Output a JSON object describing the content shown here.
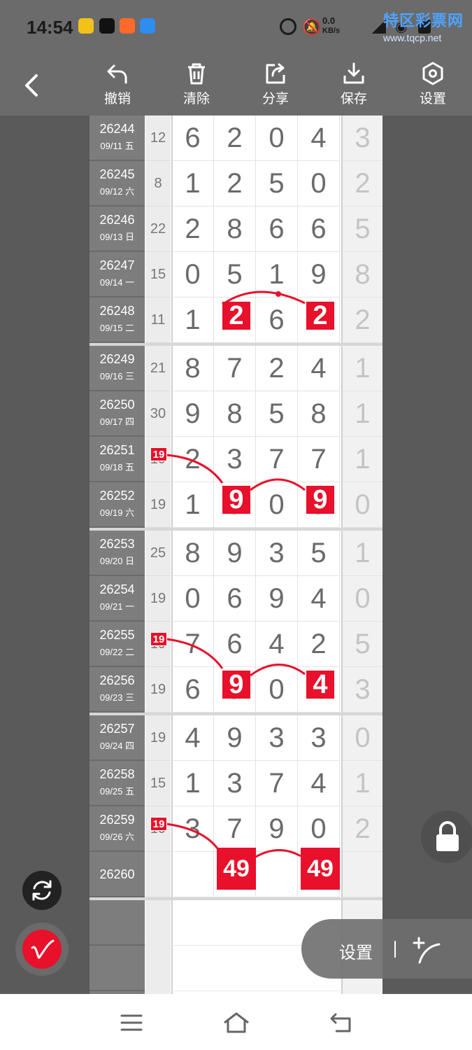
{
  "status_bar": {
    "time": "14:54",
    "net_speed": "0.0",
    "net_unit": "KB/s",
    "watermark_title": "特区彩票网",
    "watermark_url": "www.tqcp.net"
  },
  "toolbar": {
    "undo": "撤销",
    "clear": "清除",
    "share": "分享",
    "save": "保存",
    "settings": "设置"
  },
  "rows": [
    {
      "issue": "26244",
      "date": "09/11 五",
      "sum": "12",
      "digits": [
        "6",
        "2",
        "0",
        "4"
      ],
      "last": "3"
    },
    {
      "issue": "26245",
      "date": "09/12 六",
      "sum": "8",
      "digits": [
        "1",
        "2",
        "5",
        "0"
      ],
      "last": "2"
    },
    {
      "issue": "26246",
      "date": "09/13 日",
      "sum": "22",
      "digits": [
        "2",
        "8",
        "6",
        "6"
      ],
      "last": "5"
    },
    {
      "issue": "26247",
      "date": "09/14 一",
      "sum": "15",
      "digits": [
        "0",
        "5",
        "1",
        "9"
      ],
      "last": "8"
    },
    {
      "issue": "26248",
      "date": "09/15 二",
      "sum": "11",
      "digits": [
        "1",
        "2",
        "6",
        "2"
      ],
      "last": "2"
    },
    {
      "issue": "26249",
      "date": "09/16 三",
      "sum": "21",
      "digits": [
        "8",
        "7",
        "2",
        "4"
      ],
      "last": "1"
    },
    {
      "issue": "26250",
      "date": "09/17 四",
      "sum": "30",
      "digits": [
        "9",
        "8",
        "5",
        "8"
      ],
      "last": "1"
    },
    {
      "issue": "26251",
      "date": "09/18 五",
      "sum": "19",
      "digits": [
        "2",
        "3",
        "7",
        "7"
      ],
      "last": "1"
    },
    {
      "issue": "26252",
      "date": "09/19 六",
      "sum": "19",
      "digits": [
        "1",
        "9",
        "0",
        "9"
      ],
      "last": "0"
    },
    {
      "issue": "26253",
      "date": "09/20 日",
      "sum": "25",
      "digits": [
        "8",
        "9",
        "3",
        "5"
      ],
      "last": "1"
    },
    {
      "issue": "26254",
      "date": "09/21 一",
      "sum": "19",
      "digits": [
        "0",
        "6",
        "9",
        "4"
      ],
      "last": "0"
    },
    {
      "issue": "26255",
      "date": "09/22 二",
      "sum": "19",
      "digits": [
        "7",
        "6",
        "4",
        "2"
      ],
      "last": "5"
    },
    {
      "issue": "26256",
      "date": "09/23 三",
      "sum": "19",
      "digits": [
        "6",
        "9",
        "0",
        "4"
      ],
      "last": "3"
    },
    {
      "issue": "26257",
      "date": "09/24 四",
      "sum": "19",
      "digits": [
        "4",
        "9",
        "3",
        "3"
      ],
      "last": "0"
    },
    {
      "issue": "26258",
      "date": "09/25 五",
      "sum": "15",
      "digits": [
        "1",
        "3",
        "7",
        "4"
      ],
      "last": "1"
    },
    {
      "issue": "26259",
      "date": "09/26 六",
      "sum": "19",
      "digits": [
        "3",
        "7",
        "9",
        "0"
      ],
      "last": "2"
    },
    {
      "issue": "26260",
      "date": "",
      "sum": "",
      "digits": [
        "",
        "49",
        "",
        "49"
      ],
      "last": ""
    }
  ],
  "red_tags": {
    "t1": "19",
    "t2": "19",
    "t3": "19"
  },
  "highlights": {
    "h1": "2",
    "h2": "2",
    "h3": "9",
    "h4": "9",
    "h5": "9",
    "h6": "4",
    "h7": "49",
    "h8": "49"
  },
  "bottom_panel": {
    "settings_label": "设置"
  },
  "colors": {
    "accent_red": "#e8102a",
    "toolbar_gray": "#6b6b6b"
  }
}
